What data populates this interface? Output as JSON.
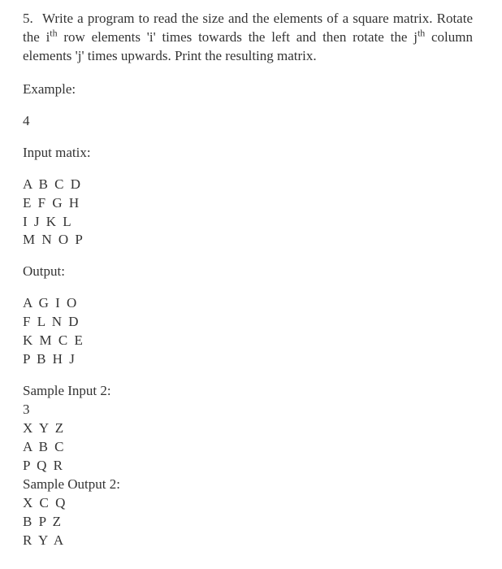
{
  "question": {
    "number": "5.",
    "text_part1": "Write a program to read the size and the elements of a square matrix. Rotate the i",
    "sup1": "th",
    "text_part2": " row elements 'i' times towards the left and then rotate the  j",
    "sup2": "th",
    "text_part3": " column elements 'j' times upwards. Print the resulting matrix."
  },
  "labels": {
    "example": "Example:",
    "size": "4",
    "input_matrix": "Input matix:",
    "output": "Output:",
    "sample_input2": "Sample Input 2:",
    "size2": "3",
    "sample_output2": "Sample Output 2:"
  },
  "matrices": {
    "input1": [
      "A B C D",
      "E F G H",
      "I J K L",
      "M N O P"
    ],
    "output1": [
      "A G I O",
      "F L N D",
      "K M C E",
      "P B H J"
    ],
    "input2": [
      "X Y Z",
      "A B C",
      "P Q R"
    ],
    "output2": [
      "X C Q",
      "B P Z",
      "R Y A"
    ]
  }
}
